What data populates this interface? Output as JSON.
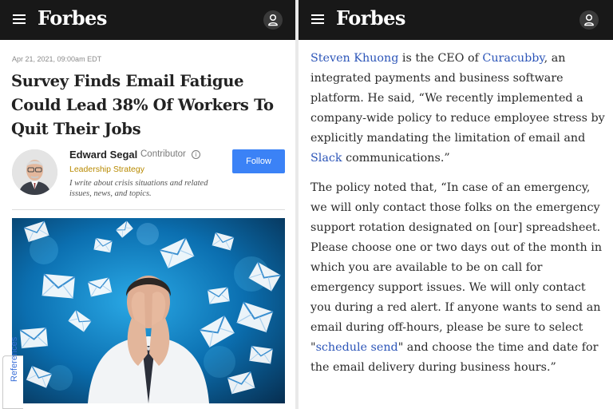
{
  "left": {
    "header": {
      "logo": "Forbes",
      "menu_icon": "hamburger-menu-icon",
      "user_icon": "user-account-icon"
    },
    "article": {
      "dateline": "Apr 21, 2021, 09:00am EDT",
      "headline": "Survey Finds Email Fatigue Could Lead 38% Of Workers To Quit Their Jobs"
    },
    "author": {
      "name": "Edward Segal",
      "role": "Contributor",
      "info_icon": "info-icon",
      "beat": "Leadership Strategy",
      "bio": "I write about crisis situations and related issues, news, and topics.",
      "follow_label": "Follow"
    },
    "hero_image": {
      "description_icon": "email-overwhelm-photo"
    },
    "side_tab": {
      "label": "References"
    }
  },
  "right": {
    "header": {
      "logo": "Forbes",
      "menu_icon": "hamburger-menu-icon",
      "user_icon": "user-account-icon"
    },
    "paragraph1": {
      "link1": "Steven Khuong",
      "t1": " is the CEO of ",
      "link2": "Curacubby",
      "t2": ", an integrated payments and business software platform. He said, “We recently implemented a company-wide policy to reduce employee stress by explicitly mandating the limitation of email and ",
      "link3": "Slack",
      "t3": " communications.”"
    },
    "paragraph2": {
      "t1": "The policy noted that, “In case of an emergency, we will only contact those folks on the emergency support rotation designated on [our] spreadsheet. Please choose one or two days out of the month in which you are available to be on call for emergency support issues. We will only contact you during a red alert. If anyone wants to send an email during off-hours, please be sure to select \"",
      "link1": "schedule send",
      "t2": "\" and choose the time and date for the email delivery during business hours.”"
    }
  },
  "colors": {
    "header_bg": "#181818",
    "link": "#2c55b8",
    "follow_button": "#3b82f6",
    "beat": "#b88a00"
  }
}
